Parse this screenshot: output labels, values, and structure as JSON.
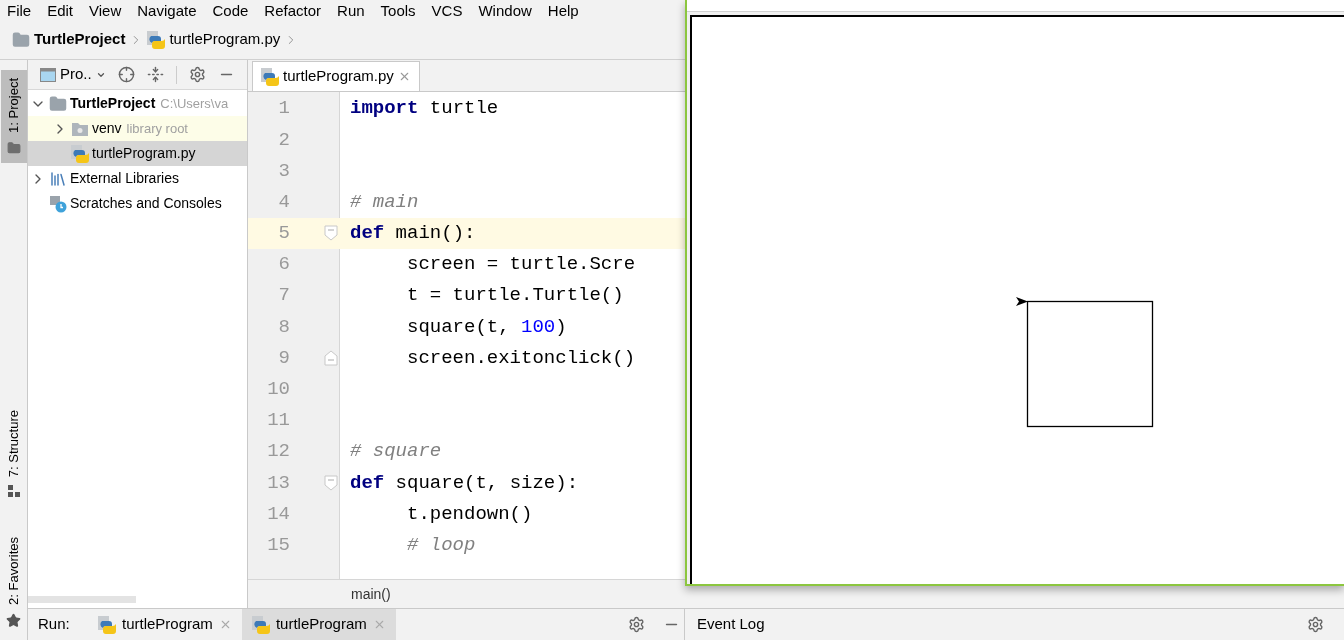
{
  "menu": [
    "File",
    "Edit",
    "View",
    "Navigate",
    "Code",
    "Refactor",
    "Run",
    "Tools",
    "VCS",
    "Window",
    "Help"
  ],
  "breadcrumb": [
    {
      "label": "TurtleProject",
      "kind": "folder"
    },
    {
      "label": "turtleProgram.py",
      "kind": "python"
    }
  ],
  "side_tabs": [
    {
      "label": "1: Project",
      "kind": "folder",
      "selected": true
    },
    {
      "label": "7: Structure",
      "kind": "structure",
      "selected": false
    },
    {
      "label": "2: Favorites",
      "kind": "star",
      "selected": false
    }
  ],
  "project_panel": {
    "title": "Pro..",
    "tree": [
      {
        "label": "TurtleProject",
        "kind": "project",
        "hint": "C:\\Users\\va",
        "expanded": true,
        "selected": false,
        "children": [
          {
            "label": "venv",
            "kind": "venv",
            "hint": "library root",
            "expanded": false,
            "selected": false
          },
          {
            "label": "turtleProgram.py",
            "kind": "python",
            "selected": true
          }
        ]
      },
      {
        "label": "External Libraries",
        "kind": "libraries",
        "expanded": false,
        "selected": false
      },
      {
        "label": "Scratches and Consoles",
        "kind": "scratches",
        "selected": false
      }
    ]
  },
  "editor": {
    "tabs": [
      {
        "label": "turtleProgram.py",
        "selected": true
      }
    ],
    "lines": [
      {
        "number": "1",
        "current": false,
        "indented": false,
        "fold_start": false,
        "fold_end": false,
        "tokens": [
          {
            "kind": "keyword",
            "text": "import"
          },
          {
            "kind": "plain",
            "text": " turtle"
          }
        ]
      },
      {
        "number": "2",
        "current": false,
        "fold_start": false,
        "fold_end": false
      },
      {
        "number": "3",
        "current": false,
        "fold_start": false,
        "fold_end": false
      },
      {
        "number": "4",
        "current": false,
        "indented": false,
        "fold_start": false,
        "fold_end": false,
        "tokens": [
          {
            "kind": "comment",
            "text": "# main"
          }
        ]
      },
      {
        "number": "5",
        "current": true,
        "indented": false,
        "fold_start": true,
        "fold_end": false,
        "tokens": [
          {
            "kind": "keyword",
            "text": "def"
          },
          {
            "kind": "plain",
            "text": " main():"
          }
        ]
      },
      {
        "number": "6",
        "current": false,
        "indented": true,
        "fold_start": false,
        "fold_end": false,
        "tokens": [
          {
            "kind": "plain",
            "text": "screen = turtle.Scre"
          }
        ]
      },
      {
        "number": "7",
        "current": false,
        "indented": true,
        "fold_start": false,
        "fold_end": false,
        "tokens": [
          {
            "kind": "plain",
            "text": "t = turtle.Turtle()"
          }
        ]
      },
      {
        "number": "8",
        "current": false,
        "indented": true,
        "fold_start": false,
        "fold_end": false,
        "tokens": [
          {
            "kind": "plain",
            "text": "square(t, "
          },
          {
            "kind": "number",
            "text": "100"
          },
          {
            "kind": "plain",
            "text": ")"
          }
        ]
      },
      {
        "number": "9",
        "current": false,
        "indented": true,
        "fold_start": false,
        "fold_end": true,
        "tokens": [
          {
            "kind": "plain",
            "text": "screen.exitonclick()"
          }
        ]
      },
      {
        "number": "10",
        "current": false,
        "fold_start": false,
        "fold_end": false
      },
      {
        "number": "11",
        "current": false,
        "fold_start": false,
        "fold_end": false
      },
      {
        "number": "12",
        "current": false,
        "indented": false,
        "fold_start": false,
        "fold_end": false,
        "tokens": [
          {
            "kind": "comment",
            "text": "# square"
          }
        ]
      },
      {
        "number": "13",
        "current": false,
        "indented": false,
        "fold_start": true,
        "fold_end": false,
        "tokens": [
          {
            "kind": "keyword",
            "text": "def"
          },
          {
            "kind": "plain",
            "text": " square(t, size):"
          }
        ]
      },
      {
        "number": "14",
        "current": false,
        "indented": true,
        "fold_start": false,
        "fold_end": false,
        "tokens": [
          {
            "kind": "plain",
            "text": "t.pendown()"
          }
        ]
      },
      {
        "number": "15",
        "current": false,
        "indented": true,
        "fold_start": false,
        "fold_end": false,
        "tokens": [
          {
            "kind": "comment",
            "text": "# loop"
          }
        ]
      }
    ],
    "breadcrumb": "main()"
  },
  "run_bar": {
    "label": "Run:",
    "tabs": [
      {
        "label": "turtleProgram",
        "selected": false
      },
      {
        "label": "turtleProgram",
        "selected": true
      }
    ]
  },
  "event_log": {
    "title": "Event Log"
  }
}
